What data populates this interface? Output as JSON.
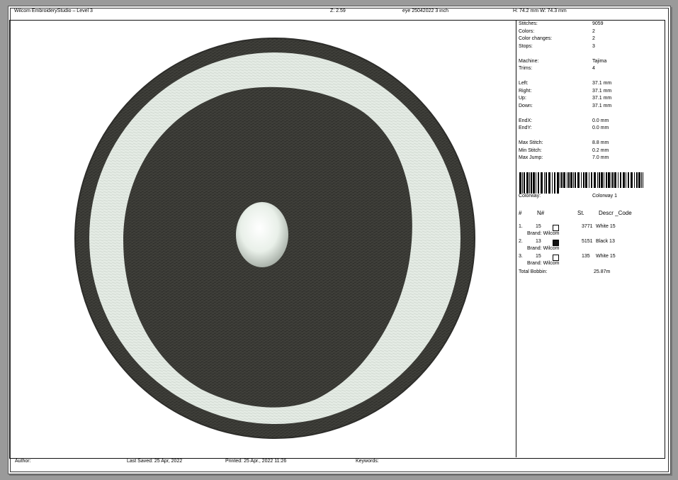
{
  "header": {
    "app_title": "Wilcom EmbroideryStudio – Level 3",
    "zoom": "Z: 2.59",
    "design_name": "eye 25042022 3 inch",
    "size": "H: 74.2 mm   W: 74.3 mm"
  },
  "stats": [
    {
      "label": "Stitches:",
      "value": "9059"
    },
    {
      "label": "Colors:",
      "value": "2"
    },
    {
      "label": "Color changes:",
      "value": "2"
    },
    {
      "label": "Stops:",
      "value": "3"
    },
    {
      "gap": true
    },
    {
      "label": "Machine:",
      "value": "Tajima"
    },
    {
      "label": "Trims:",
      "value": "4"
    },
    {
      "gap": true
    },
    {
      "label": "Left:",
      "value": "37.1 mm"
    },
    {
      "label": "Right:",
      "value": "37.1 mm"
    },
    {
      "label": "Up:",
      "value": "37.1 mm"
    },
    {
      "label": "Down:",
      "value": "37.1 mm"
    },
    {
      "gap": true
    },
    {
      "label": "EndX:",
      "value": "0.0 mm"
    },
    {
      "label": "EndY:",
      "value": "0.0 mm"
    },
    {
      "gap": true
    },
    {
      "label": "Max Stitch:",
      "value": "8.8 mm"
    },
    {
      "label": "Min Stitch:",
      "value": "0.2 mm"
    },
    {
      "label": "Max Jump:",
      "value": "7.0 mm"
    }
  ],
  "colorway": {
    "label": "Colorway:",
    "value": "Colorway 1"
  },
  "thread_table": {
    "headers": {
      "num": "#",
      "needle": "N#",
      "stitches": "St.",
      "descr": "Descr _Code"
    },
    "rows": [
      {
        "idx": "1.",
        "needle": "15",
        "stitches": "3771",
        "descr": "White 15",
        "brand": "Brand: Wilcom",
        "swatch": "#ffffff"
      },
      {
        "idx": "2.",
        "needle": "13",
        "stitches": "5151",
        "descr": "Black 13",
        "brand": "Brand: Wilcom",
        "swatch": "#111111"
      },
      {
        "idx": "3.",
        "needle": "15",
        "stitches": "135",
        "descr": "White 15",
        "brand": "Brand: Wilcom",
        "swatch": "#ffffff"
      }
    ],
    "total_label": "Total Bobbin:",
    "total_value": "25.87m"
  },
  "footer": {
    "author": "Author:",
    "last_saved": "Last Saved: 25 Apr, 2022",
    "printed": "Printed: 25 Apr., 2022 11:26",
    "keywords": "Keywords:"
  },
  "colors": {
    "black_thread": "#3b3b36",
    "white_thread": "#e6ece6",
    "background": "#9a9a9a"
  }
}
